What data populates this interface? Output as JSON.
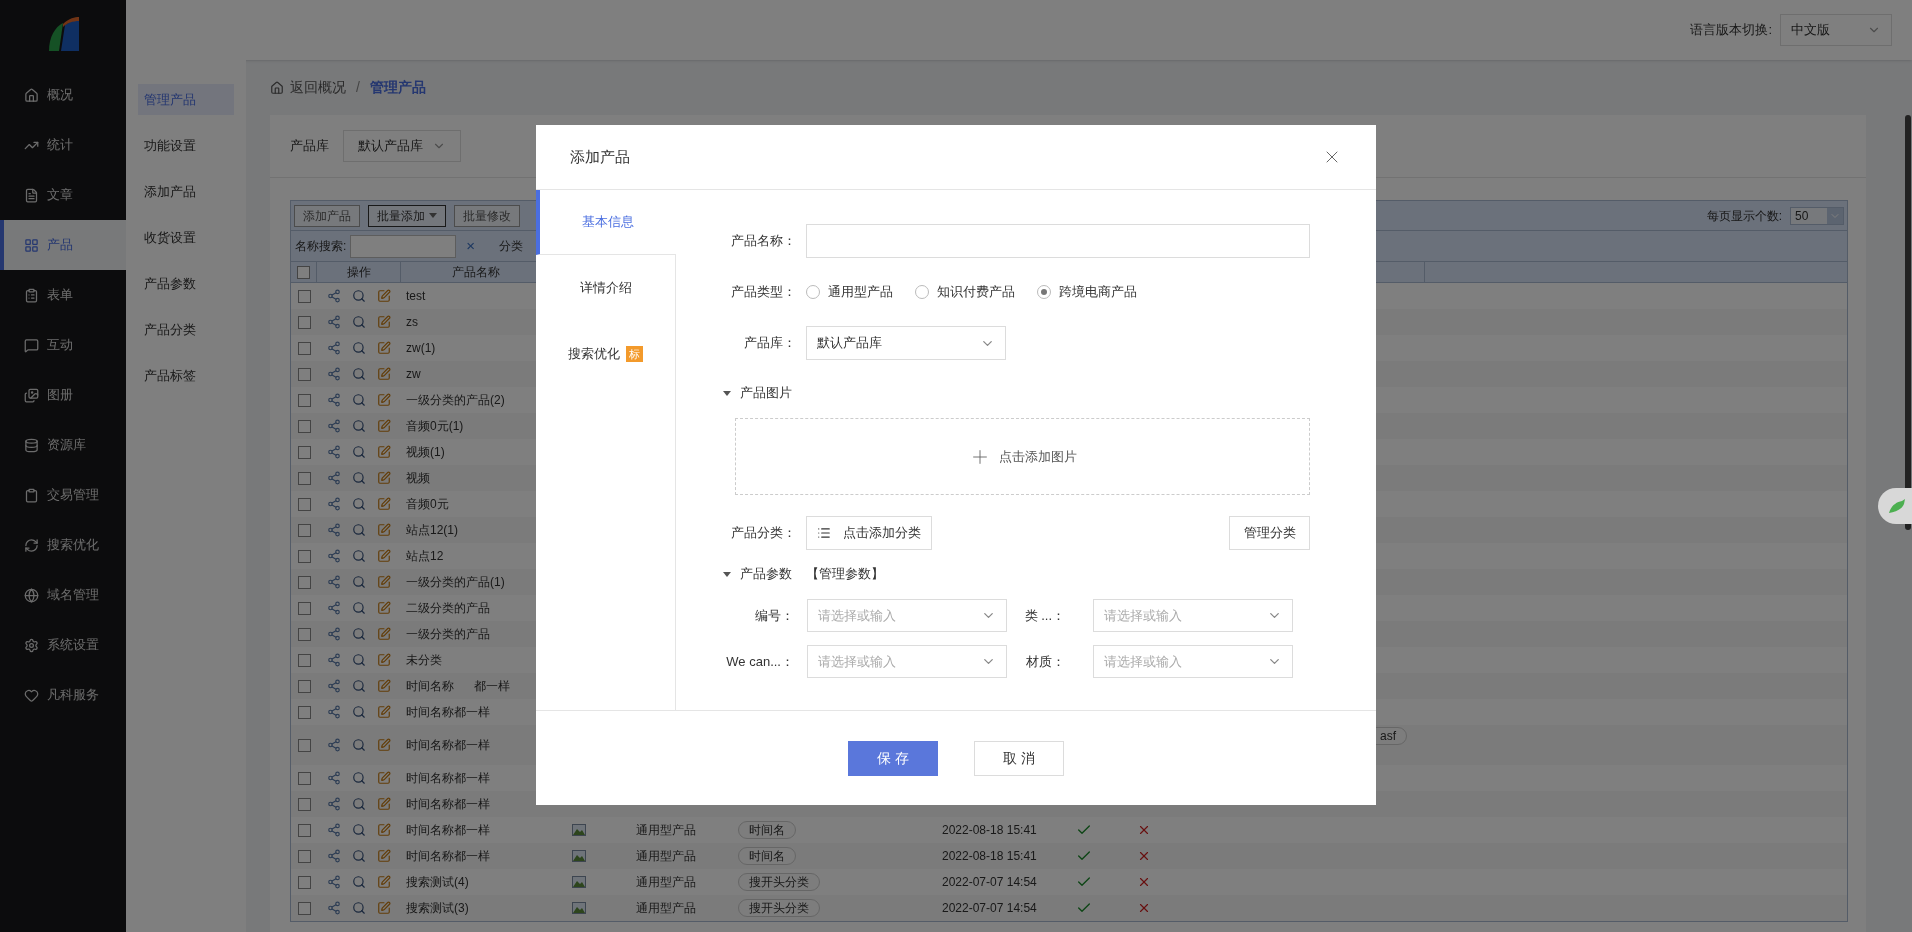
{
  "nav": [
    {
      "label": "概况",
      "selected": false
    },
    {
      "label": "统计",
      "selected": false
    },
    {
      "label": "文章",
      "selected": false
    },
    {
      "label": "产品",
      "selected": true
    },
    {
      "label": "表单",
      "selected": false
    },
    {
      "label": "互动",
      "selected": false
    },
    {
      "label": "图册",
      "selected": false
    },
    {
      "label": "资源库",
      "selected": false
    },
    {
      "label": "交易管理",
      "selected": false
    },
    {
      "label": "搜索优化",
      "selected": false
    },
    {
      "label": "域名管理",
      "selected": false
    },
    {
      "label": "系统设置",
      "selected": false
    },
    {
      "label": "凡科服务",
      "selected": false
    }
  ],
  "subnav": [
    {
      "label": "管理产品",
      "selected": true
    },
    {
      "label": "功能设置",
      "selected": false
    },
    {
      "label": "添加产品",
      "selected": false
    },
    {
      "label": "收货设置",
      "selected": false
    },
    {
      "label": "产品参数",
      "selected": false
    },
    {
      "label": "产品分类",
      "selected": false
    },
    {
      "label": "产品标签",
      "selected": false
    }
  ],
  "header": {
    "language_label": "语言版本切换:",
    "language": "中文版"
  },
  "breadcrumb": {
    "back": "返回概况",
    "separator": "/",
    "current": "管理产品"
  },
  "library_filter": {
    "label": "产品库",
    "value": "默认产品库"
  },
  "toolbar": {
    "buttons": [
      {
        "label": "添加产品",
        "kind": "plain"
      },
      {
        "label": "批量添加",
        "kind": "dropdown"
      },
      {
        "label": "批量修改",
        "kind": "plain"
      }
    ],
    "page_size_label": "每页显示个数:",
    "page_size": "50"
  },
  "search": {
    "label": "名称搜索:",
    "clear": "×",
    "category_label": "分类"
  },
  "table": {
    "select_all_checked": false,
    "columns": [
      "操作",
      "产品名称"
    ],
    "rows": [
      {
        "name": "test",
        "checked": false
      },
      {
        "name": "zs",
        "checked": false
      },
      {
        "name": "zw(1)",
        "checked": false
      },
      {
        "name": "zw",
        "checked": false
      },
      {
        "name": "一级分类的产品(2)",
        "checked": false
      },
      {
        "name": "音频0元(1)",
        "checked": false
      },
      {
        "name": "视频(1)",
        "checked": false
      },
      {
        "name": "视频",
        "checked": false
      },
      {
        "name": "音频0元",
        "checked": false
      },
      {
        "name": "站点12(1)",
        "checked": false
      },
      {
        "name": "站点12",
        "checked": false
      },
      {
        "name": "一级分类的产品(1)",
        "checked": false
      },
      {
        "name": "二级分类的产品",
        "checked": false
      },
      {
        "name": "一级分类的产品",
        "checked": false
      },
      {
        "name": "未分类",
        "checked": false
      },
      {
        "name": "时间名称      都一样",
        "checked": false
      },
      {
        "name": "时间名称都一样",
        "checked": false
      },
      {
        "name": "时间名称都一样",
        "checked": false,
        "extra_tag": "asf"
      },
      {
        "name": "时间名称都一样",
        "checked": false
      },
      {
        "name": "时间名称都一样",
        "checked": false
      },
      {
        "name": "时间名称都一样",
        "checked": false,
        "type": "通用型产品",
        "tag": "时间名",
        "date": "2022-08-18 15:41",
        "column_7": true,
        "column_8": false
      },
      {
        "name": "时间名称都一样",
        "checked": false,
        "type": "通用型产品",
        "tag": "时间名",
        "date": "2022-08-18 15:41",
        "column_7": true,
        "column_8": false
      },
      {
        "name": "搜索测试(4)",
        "checked": false,
        "type": "通用型产品",
        "tag": "搜开头分类",
        "date": "2022-07-07 14:54",
        "column_7": true,
        "column_8": false
      },
      {
        "name": "搜索测试(3)",
        "checked": false,
        "type": "通用型产品",
        "tag": "搜开头分类",
        "date": "2022-07-07 14:54",
        "column_7": true,
        "column_8": false
      }
    ]
  },
  "dialog": {
    "title": "添加产品",
    "tabs": [
      {
        "label": "基本信息",
        "selected": true
      },
      {
        "label": "详情介绍",
        "selected": false
      },
      {
        "label": "搜索优化",
        "selected": false,
        "badge": "标"
      }
    ],
    "form": {
      "name_label": "产品名称：",
      "type_label": "产品类型：",
      "type_options": [
        {
          "label": "通用型产品",
          "selected": false
        },
        {
          "label": "知识付费产品",
          "selected": false
        },
        {
          "label": "跨境电商产品",
          "selected": true
        }
      ],
      "library_label": "产品库：",
      "library_value": "默认产品库",
      "images_section": {
        "title": "产品图片",
        "expanded": true,
        "add_text": "点击添加图片"
      },
      "category_label": "产品分类：",
      "category_button": "点击添加分类",
      "manage_category": "管理分类",
      "params_section": {
        "title": "产品参数",
        "expanded": true,
        "link": "【管理参数】"
      },
      "params": [
        {
          "label": "编号：",
          "placeholder": "请选择或输入"
        },
        {
          "label": "类 ...：",
          "placeholder": "请选择或输入"
        },
        {
          "label": "We can...：",
          "placeholder": "请选择或输入"
        },
        {
          "label": "材质：",
          "placeholder": "请选择或输入"
        }
      ]
    },
    "buttons": [
      {
        "label": "保 存",
        "kind": "primary"
      },
      {
        "label": "取 消",
        "kind": "default"
      }
    ]
  }
}
